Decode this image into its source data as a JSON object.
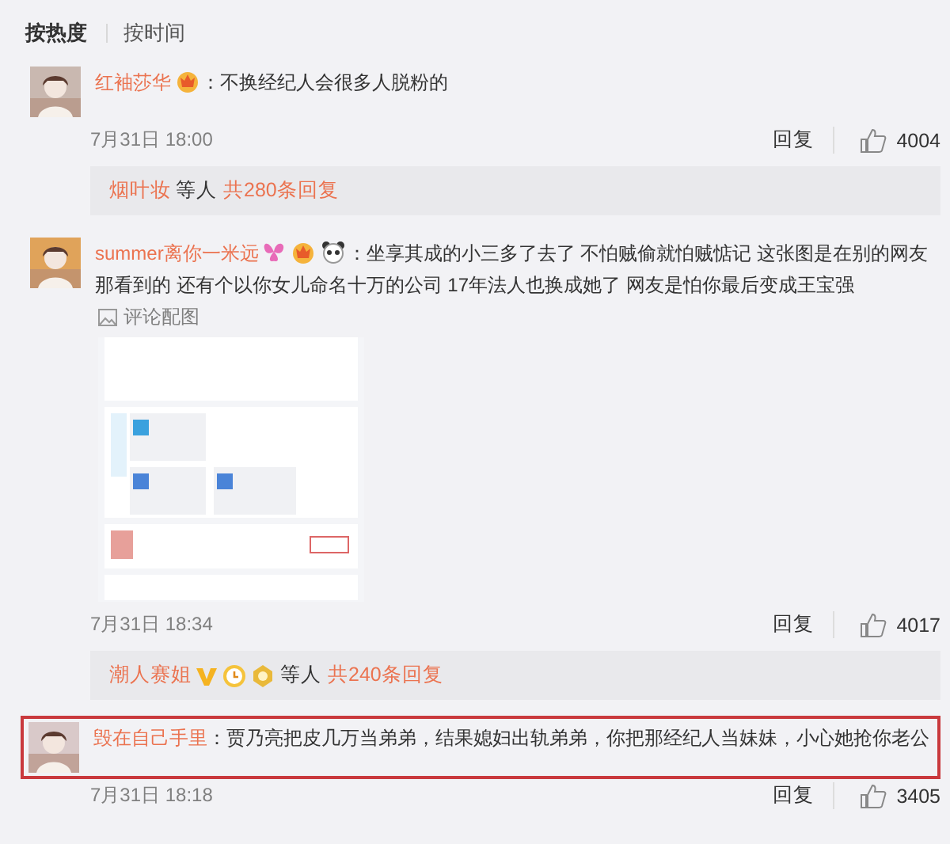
{
  "sort_tabs": [
    {
      "label": "按热度",
      "selected": true
    },
    {
      "label": "按时间",
      "selected": false
    }
  ],
  "comments": [
    {
      "author": "红袖莎华",
      "text": "：不换经纪人会很多人脱粉的",
      "time": "7月31日 18:00",
      "reply_label": "回复",
      "likes": "4004",
      "highlighted": false,
      "replies": {
        "names": [
          {
            "name": "烟叶妆"
          }
        ],
        "suffix": "等人",
        "count": "共280条回复"
      }
    },
    {
      "author": "summer离你一米远",
      "text": "：坐享其成的小三多了去了 不怕贼偷就怕贼惦记 这张图是在别的网友那看到的 还有个以你女儿命名十万的公司 17年法人也换成她了 网友是怕你最后变成王宝强",
      "image": {
        "caption": "评论配图",
        "kind": "picture"
      },
      "time": "7月31日 18:34",
      "reply_label": "回复",
      "likes": "4017",
      "highlighted": false,
      "replies": {
        "names": [
          {
            "name": "潮人赛姐"
          }
        ],
        "suffix": "等人",
        "count": "共240条回复"
      }
    },
    {
      "author": "毁在自己手里",
      "text": "：贾乃亮把皮几万当弟弟，结果媳妇出轨弟弟，你把那经纪人当妹妹，小心她抢你老公",
      "time": "7月31日 18:18",
      "reply_label": "回复",
      "likes": "3405",
      "highlighted": true
    }
  ]
}
